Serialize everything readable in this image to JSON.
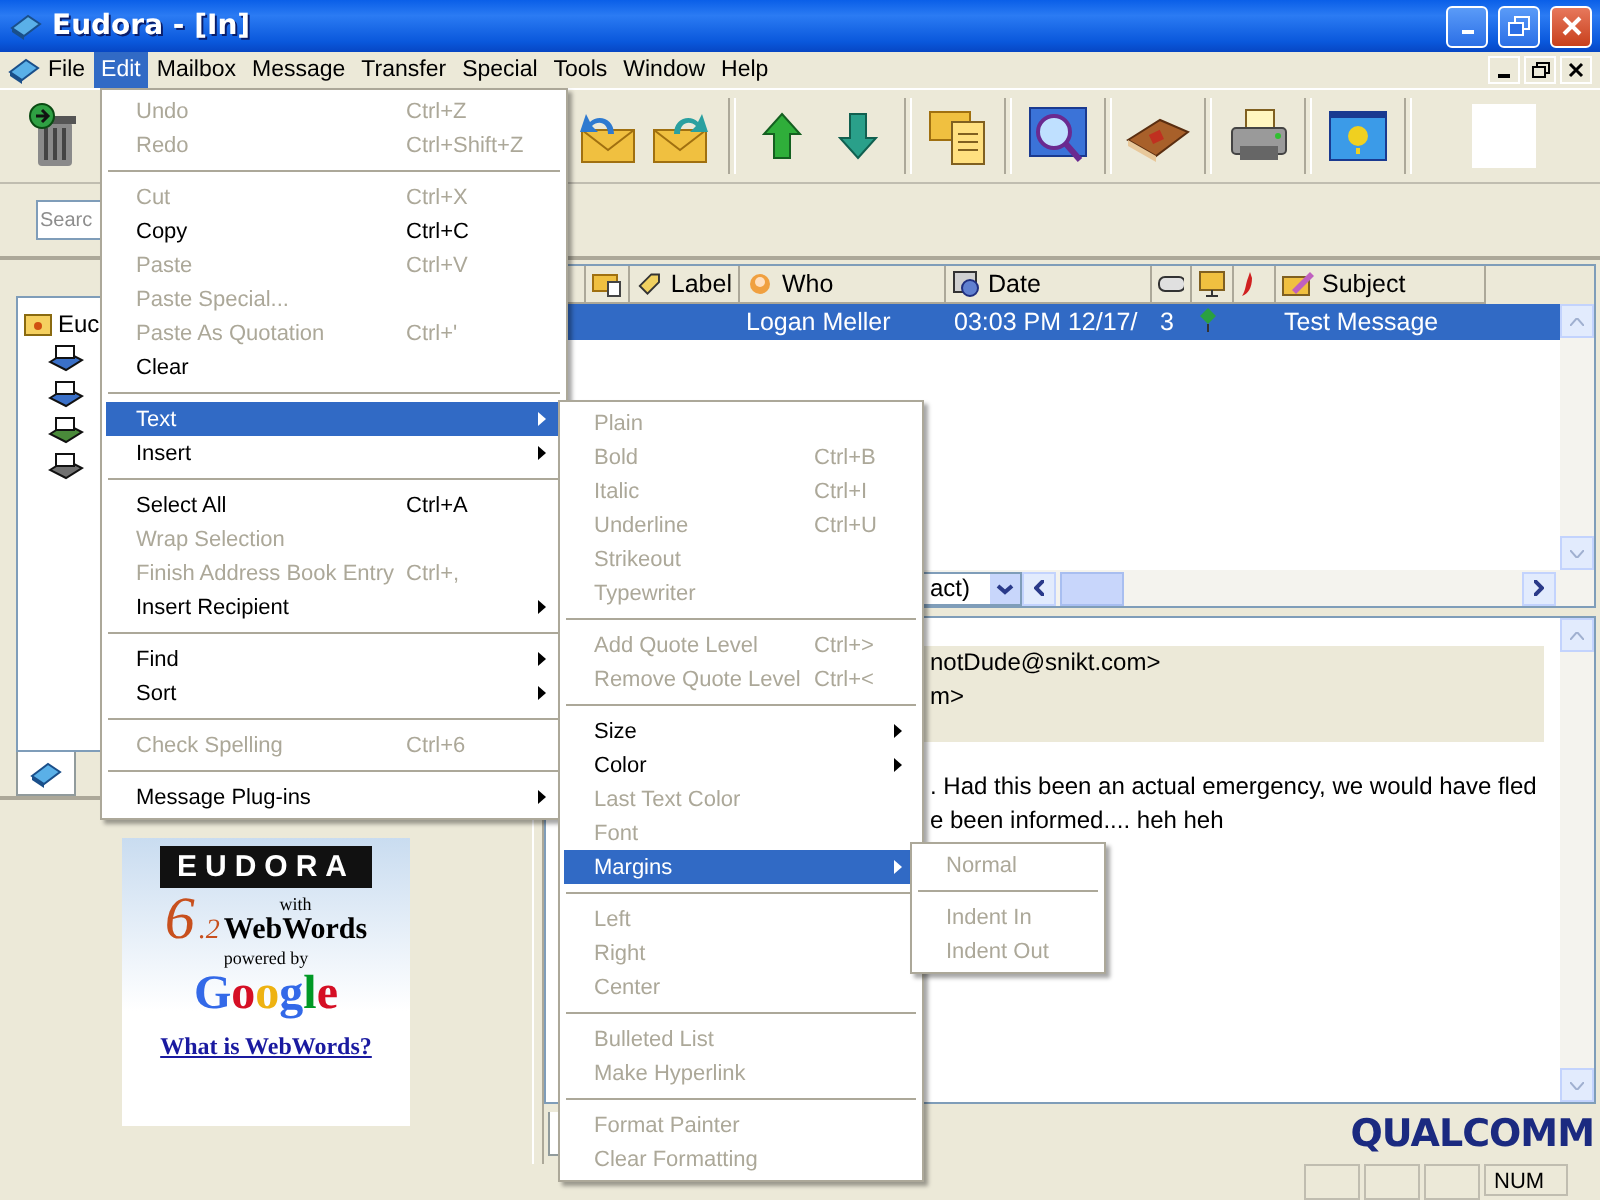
{
  "window": {
    "title": "Eudora - [In]"
  },
  "menu_bar": [
    {
      "label": "File",
      "selected": false
    },
    {
      "label": "Edit",
      "selected": true
    },
    {
      "label": "Mailbox",
      "selected": false
    },
    {
      "label": "Message",
      "selected": false
    },
    {
      "label": "Transfer",
      "selected": false
    },
    {
      "label": "Special",
      "selected": false
    },
    {
      "label": "Tools",
      "selected": false
    },
    {
      "label": "Window",
      "selected": false
    },
    {
      "label": "Help",
      "selected": false
    }
  ],
  "search": {
    "placeholder": "Searc"
  },
  "mailbox_tree": {
    "root": "Euc"
  },
  "message_list": {
    "columns": [
      "Label",
      "Who",
      "Date",
      "Subject"
    ],
    "rows": [
      {
        "who": "Logan Meller",
        "date": "03:03 PM 12/17/",
        "priority": "3",
        "subject": "Test Message",
        "selected": true
      }
    ],
    "view_combo": "act)"
  },
  "preview": {
    "header_lines": [
      "notDude@snikt.com>",
      "m>"
    ],
    "body_lines": [
      ". Had this been an actual emergency, we would have fled",
      "e been informed.... heh heh"
    ]
  },
  "ad": {
    "brand": "EUDORA",
    "version_major": "6",
    "version_minor": ".2",
    "with": "with",
    "product": "WebWords",
    "powered_by": "powered by",
    "partner": "Google",
    "link": "What is WebWords?"
  },
  "logo": "QUALCOMM",
  "status_bar": {
    "indicator": "NUM"
  },
  "edit_menu": {
    "items": [
      {
        "kind": "item",
        "label": "Undo",
        "shortcut": "Ctrl+Z",
        "disabled": true,
        "submenu": false,
        "selected": false
      },
      {
        "kind": "item",
        "label": "Redo",
        "shortcut": "Ctrl+Shift+Z",
        "disabled": true,
        "submenu": false,
        "selected": false
      },
      {
        "kind": "separator"
      },
      {
        "kind": "item",
        "label": "Cut",
        "shortcut": "Ctrl+X",
        "disabled": true,
        "submenu": false,
        "selected": false
      },
      {
        "kind": "item",
        "label": "Copy",
        "shortcut": "Ctrl+C",
        "disabled": false,
        "submenu": false,
        "selected": false
      },
      {
        "kind": "item",
        "label": "Paste",
        "shortcut": "Ctrl+V",
        "disabled": true,
        "submenu": false,
        "selected": false
      },
      {
        "kind": "item",
        "label": "Paste Special...",
        "disabled": true,
        "submenu": false,
        "selected": false
      },
      {
        "kind": "item",
        "label": "Paste As Quotation",
        "shortcut": "Ctrl+'",
        "disabled": true,
        "submenu": false,
        "selected": false
      },
      {
        "kind": "item",
        "label": "Clear",
        "disabled": false,
        "submenu": false,
        "selected": false
      },
      {
        "kind": "separator"
      },
      {
        "kind": "item",
        "label": "Text",
        "disabled": false,
        "submenu": true,
        "selected": true
      },
      {
        "kind": "item",
        "label": "Insert",
        "disabled": false,
        "submenu": true,
        "selected": false
      },
      {
        "kind": "separator"
      },
      {
        "kind": "item",
        "label": "Select All",
        "shortcut": "Ctrl+A",
        "disabled": false,
        "submenu": false,
        "selected": false
      },
      {
        "kind": "item",
        "label": "Wrap Selection",
        "disabled": true,
        "submenu": false,
        "selected": false
      },
      {
        "kind": "item",
        "label": "Finish Address Book Entry",
        "shortcut": "Ctrl+,",
        "disabled": true,
        "submenu": false,
        "selected": false
      },
      {
        "kind": "item",
        "label": "Insert Recipient",
        "disabled": false,
        "submenu": true,
        "selected": false
      },
      {
        "kind": "separator"
      },
      {
        "kind": "item",
        "label": "Find",
        "disabled": false,
        "submenu": true,
        "selected": false
      },
      {
        "kind": "item",
        "label": "Sort",
        "disabled": false,
        "submenu": true,
        "selected": false
      },
      {
        "kind": "separator"
      },
      {
        "kind": "item",
        "label": "Check Spelling",
        "shortcut": "Ctrl+6",
        "disabled": true,
        "submenu": false,
        "selected": false
      },
      {
        "kind": "separator"
      },
      {
        "kind": "item",
        "label": "Message Plug-ins",
        "disabled": false,
        "submenu": true,
        "selected": false
      }
    ]
  },
  "text_submenu": {
    "items": [
      {
        "kind": "item",
        "label": "Plain",
        "disabled": true,
        "submenu": false,
        "selected": false
      },
      {
        "kind": "item",
        "label": "Bold",
        "shortcut": "Ctrl+B",
        "disabled": true,
        "submenu": false,
        "selected": false
      },
      {
        "kind": "item",
        "label": "Italic",
        "shortcut": "Ctrl+I",
        "disabled": true,
        "submenu": false,
        "selected": false
      },
      {
        "kind": "item",
        "label": "Underline",
        "shortcut": "Ctrl+U",
        "disabled": true,
        "submenu": false,
        "selected": false
      },
      {
        "kind": "item",
        "label": "Strikeout",
        "disabled": true,
        "submenu": false,
        "selected": false
      },
      {
        "kind": "item",
        "label": "Typewriter",
        "disabled": true,
        "submenu": false,
        "selected": false
      },
      {
        "kind": "separator"
      },
      {
        "kind": "item",
        "label": "Add Quote Level",
        "shortcut": "Ctrl+>",
        "disabled": true,
        "submenu": false,
        "selected": false
      },
      {
        "kind": "item",
        "label": "Remove Quote Level",
        "shortcut": "Ctrl+<",
        "disabled": true,
        "submenu": false,
        "selected": false
      },
      {
        "kind": "separator"
      },
      {
        "kind": "item",
        "label": "Size",
        "disabled": false,
        "submenu": true,
        "selected": false
      },
      {
        "kind": "item",
        "label": "Color",
        "disabled": false,
        "submenu": true,
        "selected": false
      },
      {
        "kind": "item",
        "label": "Last Text Color",
        "disabled": true,
        "submenu": false,
        "selected": false
      },
      {
        "kind": "item",
        "label": "Font",
        "disabled": true,
        "submenu": false,
        "selected": false
      },
      {
        "kind": "item",
        "label": "Margins",
        "disabled": false,
        "submenu": true,
        "selected": true
      },
      {
        "kind": "separator"
      },
      {
        "kind": "item",
        "label": "Left",
        "disabled": true,
        "submenu": false,
        "selected": false
      },
      {
        "kind": "item",
        "label": "Right",
        "disabled": true,
        "submenu": false,
        "selected": false
      },
      {
        "kind": "item",
        "label": "Center",
        "disabled": true,
        "submenu": false,
        "selected": false
      },
      {
        "kind": "separator"
      },
      {
        "kind": "item",
        "label": "Bulleted List",
        "disabled": true,
        "submenu": false,
        "selected": false
      },
      {
        "kind": "item",
        "label": "Make Hyperlink",
        "disabled": true,
        "submenu": false,
        "selected": false
      },
      {
        "kind": "separator"
      },
      {
        "kind": "item",
        "label": "Format Painter",
        "disabled": true,
        "submenu": false,
        "selected": false
      },
      {
        "kind": "item",
        "label": "Clear Formatting",
        "disabled": true,
        "submenu": false,
        "selected": false
      }
    ]
  },
  "margins_submenu": {
    "items": [
      {
        "kind": "item",
        "label": "Normal",
        "disabled": true,
        "submenu": false,
        "selected": false
      },
      {
        "kind": "separator"
      },
      {
        "kind": "item",
        "label": "Indent In",
        "disabled": true,
        "submenu": false,
        "selected": false
      },
      {
        "kind": "item",
        "label": "Indent Out",
        "disabled": true,
        "submenu": false,
        "selected": false
      }
    ]
  }
}
